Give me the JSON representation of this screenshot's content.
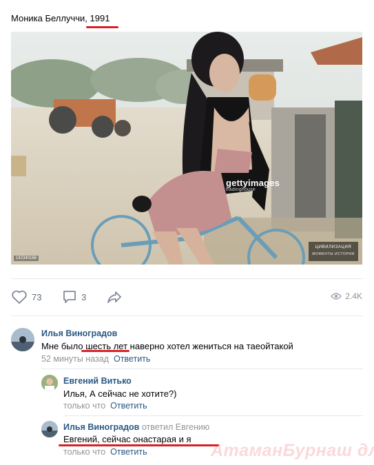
{
  "post": {
    "title_name": "Моника Беллуччи, ",
    "title_year": "1991",
    "image_watermark": "gettyimages",
    "image_watermark_sub": "tradinghouse",
    "image_id": "142340166",
    "civ_line1": "ЦИВИЛИЗАЦИЯ",
    "civ_line2": "МОМЕНТЫ ИСТОРИИ"
  },
  "actions": {
    "likes": "73",
    "comments": "3",
    "views": "2.4K"
  },
  "comments": [
    {
      "author": "Илья Виноградов",
      "text_before": "Мне было ",
      "text_mid": "шесть лет",
      "text_after": " наверно хотел жениться на таеойтакой",
      "time": "52 минуты назад",
      "reply_label": "Ответить"
    },
    {
      "author": "Евгений Витько",
      "text": "Илья, А сейчас не хотите?)",
      "time": "только что",
      "reply_label": "Ответить"
    },
    {
      "author": "Илья Виноградов",
      "replied_to": "ответил Евгению",
      "text": "Евгений, сейчас онастарая и я",
      "time": "только что",
      "reply_label": "Ответить"
    }
  ],
  "watermark": "АтаманБурнаш для ЯП",
  "colors": {
    "link": "#2a5885",
    "muted": "#939393",
    "highlight": "#d81f26"
  },
  "icons": [
    "heart-icon",
    "comment-icon",
    "share-icon",
    "eye-icon"
  ]
}
